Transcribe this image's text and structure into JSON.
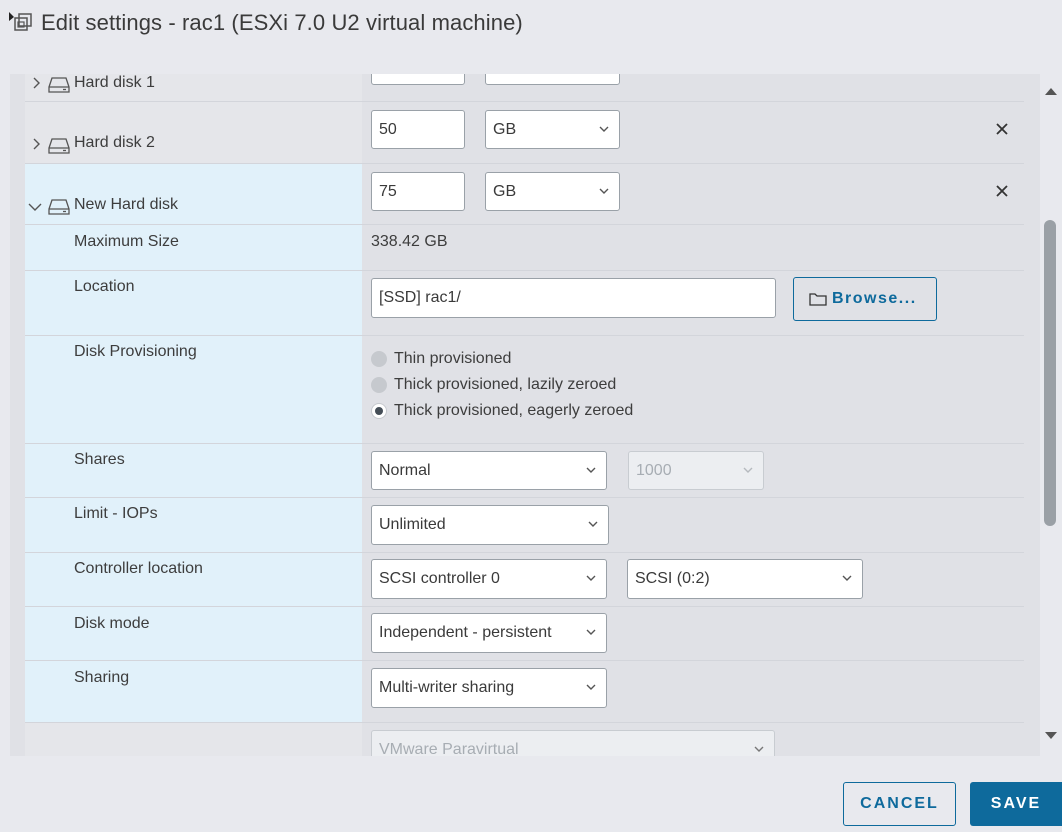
{
  "window": {
    "title": "Edit settings - rac1 (ESXi 7.0 U2 virtual machine)"
  },
  "hard_disk_1": {
    "label": "Hard disk 1"
  },
  "hard_disk_2": {
    "label": "Hard disk 2",
    "size": "50",
    "unit": "GB"
  },
  "new_disk": {
    "label": "New Hard disk",
    "size": "75",
    "unit": "GB",
    "max_size": {
      "label": "Maximum Size",
      "value": "338.42 GB"
    },
    "location": {
      "label": "Location",
      "value": "[SSD] rac1/",
      "browse_label": "Browse..."
    },
    "provisioning": {
      "label": "Disk Provisioning",
      "options": [
        "Thin provisioned",
        "Thick provisioned, lazily zeroed",
        "Thick provisioned, eagerly zeroed"
      ],
      "selected": "Thick provisioned, eagerly zeroed"
    },
    "shares": {
      "label": "Shares",
      "value": "Normal",
      "amount": "1000"
    },
    "limit": {
      "label": "Limit - IOPs",
      "value": "Unlimited"
    },
    "controller": {
      "label": "Controller location",
      "controller": "SCSI controller 0",
      "slot": "SCSI (0:2)"
    },
    "disk_mode": {
      "label": "Disk mode",
      "value": "Independent - persistent"
    },
    "sharing": {
      "label": "Sharing",
      "value": "Multi-writer sharing"
    }
  },
  "next_controller": {
    "value": "VMware Paravirtual"
  },
  "footer": {
    "cancel_label": "CANCEL",
    "save_label": "SAVE"
  },
  "colors": {
    "accent": "#0e6a9c",
    "row_highlight": "#e1f1fa",
    "background": "#e0e1e6"
  }
}
